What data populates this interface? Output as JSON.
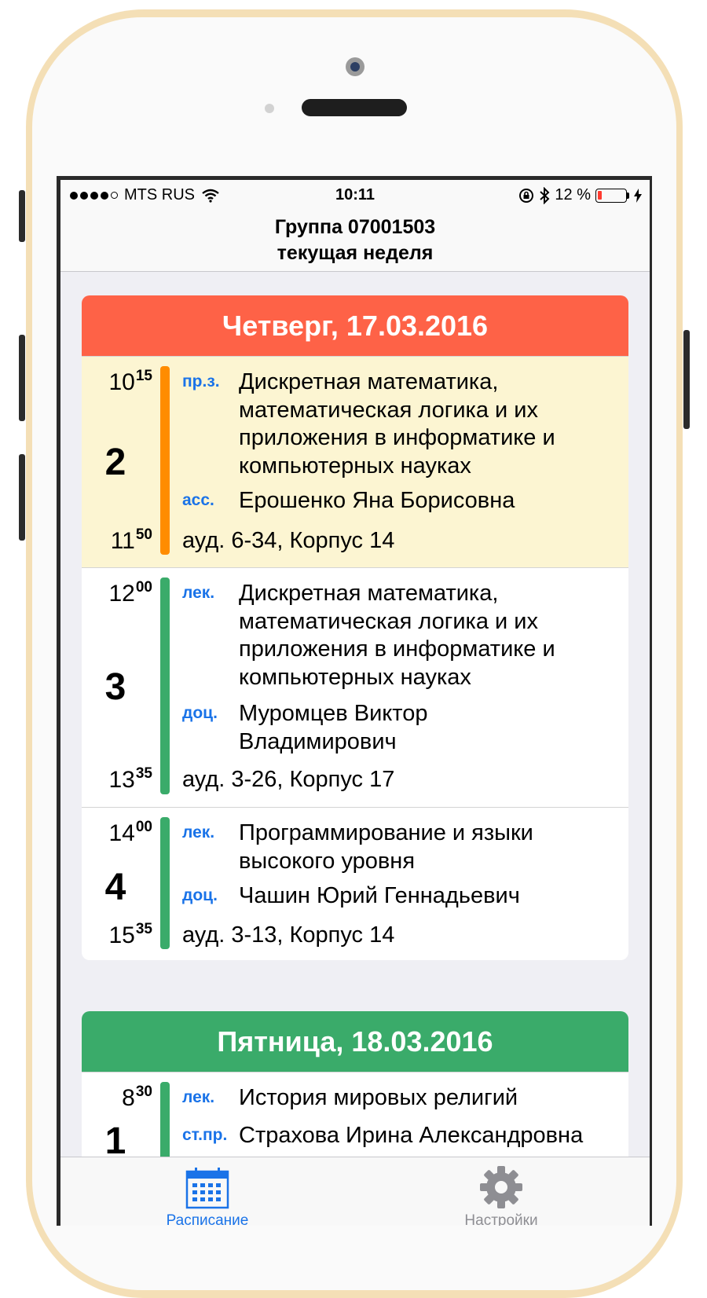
{
  "status_bar": {
    "carrier": "MTS RUS",
    "time": "10:11",
    "battery": "12 %",
    "signal_bars": 4,
    "icons": [
      "wifi-icon",
      "rotation-lock-icon",
      "bluetooth-icon",
      "battery-icon",
      "charging-icon"
    ]
  },
  "navbar": {
    "title": "Группа 07001503",
    "subtitle": "текущая неделя"
  },
  "days": [
    {
      "header": "Четверг, 17.03.2016",
      "color": "#fe6247",
      "lessons": [
        {
          "start_h": "10",
          "start_m": "15",
          "end_h": "11",
          "end_m": "50",
          "number": "2",
          "type": "пр.з.",
          "subject": "Дискретная математика, математическая логика и их приложения в информатике и компьютерных науках",
          "teacher_role": "асс.",
          "teacher": "Ерошенко Яна Борисовна",
          "room": "ауд. 6-34, Корпус 14",
          "bar_color": "#ff8c00",
          "bg": "#fcf5d2"
        },
        {
          "start_h": "12",
          "start_m": "00",
          "end_h": "13",
          "end_m": "35",
          "number": "3",
          "type": "лек.",
          "subject": "Дискретная математика, математическая логика и их приложения в информатике и компьютерных науках",
          "teacher_role": "доц.",
          "teacher": "Муромцев Виктор Владимирович",
          "room": "ауд. 3-26, Корпус 17",
          "bar_color": "#3aab6a",
          "bg": "#ffffff"
        },
        {
          "start_h": "14",
          "start_m": "00",
          "end_h": "15",
          "end_m": "35",
          "number": "4",
          "type": "лек.",
          "subject": "Программирование и языки высокого уровня",
          "teacher_role": "доц.",
          "teacher": "Чашин Юрий Геннадьевич",
          "room": "ауд. 3-13, Корпус 14",
          "bar_color": "#3aab6a",
          "bg": "#ffffff"
        }
      ]
    },
    {
      "header": "Пятница, 18.03.2016",
      "color": "#3aab6a",
      "lessons": [
        {
          "start_h": "8",
          "start_m": "30",
          "number": "1",
          "type": "лек.",
          "subject": "История мировых религий",
          "teacher_role": "ст.пр.",
          "teacher": "Страхова Ирина Александровна",
          "bar_color": "#3aab6a",
          "bg": "#ffffff"
        }
      ]
    }
  ],
  "tabbar": {
    "schedule": "Расписание",
    "settings": "Настройки",
    "active_color": "#1a73e8",
    "inactive_color": "#8e8e93"
  }
}
